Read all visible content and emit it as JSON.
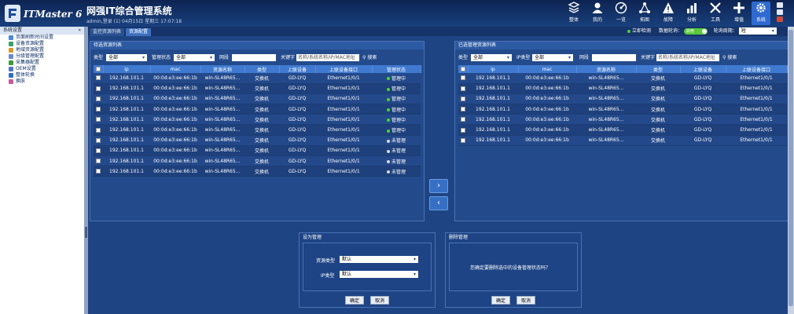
{
  "header": {
    "logo_text": "ITMaster 6",
    "title": "网强IT综合管理系统",
    "login_info": "admin,登录 (1) 04月15日 星期三 17:07:18",
    "nav": [
      {
        "label": "整体",
        "icon": "overview-icon"
      },
      {
        "label": "我的",
        "icon": "user-icon"
      },
      {
        "label": "一览",
        "icon": "dashboard-icon"
      },
      {
        "label": "拓图",
        "icon": "topology-icon"
      },
      {
        "label": "故障",
        "icon": "warning-icon"
      },
      {
        "label": "分析",
        "icon": "chart-icon"
      },
      {
        "label": "工具",
        "icon": "tools-icon"
      },
      {
        "label": "增值",
        "icon": "plus-icon"
      },
      {
        "label": "系统",
        "icon": "gear-icon"
      }
    ]
  },
  "sidebar": {
    "title": "系统设置",
    "items": [
      {
        "label": "页面刷新时间设置"
      },
      {
        "label": "设备资源配置"
      },
      {
        "label": "地域资源配置"
      },
      {
        "label": "分级管理配置"
      },
      {
        "label": "采集器配置"
      },
      {
        "label": "OEM设置"
      },
      {
        "label": "整体轮换"
      },
      {
        "label": "换肤"
      }
    ]
  },
  "tabs": [
    {
      "label": "监控资源列表"
    },
    {
      "label": "资源配置"
    }
  ],
  "controls": {
    "instant_detect": "立即检测",
    "data_poll_label": "数据轮询：",
    "data_poll_value": "启用",
    "poll_cycle_label": "轮询周期：",
    "poll_cycle_value": "短"
  },
  "left_panel": {
    "title": "待选资源列表",
    "filter": {
      "type_label": "类型",
      "type_value": "全部",
      "status_label": "管理状态",
      "status_value": "全部",
      "segment_label": "网段",
      "keyword_label": "关键字",
      "keyword_placeholder": "名称/系统名称/IP/MAC地址",
      "search": "搜索"
    },
    "columns": [
      "ip",
      "mac",
      "资源名称",
      "类型",
      "上联设备",
      "上联设备接口",
      "管理状态"
    ],
    "rows": [
      {
        "ip": "192.168.101.1",
        "mac": "00:0d:e3:ee:66:1b",
        "name": "win-SL48R65...",
        "type": "交换机",
        "uplink": "GD-LYQ",
        "port": "Ethernet1/0/1",
        "status": "管理中"
      },
      {
        "ip": "192.168.101.1",
        "mac": "00:0d:e3:ee:66:1b",
        "name": "win-SL48R65...",
        "type": "交换机",
        "uplink": "GD-LYQ",
        "port": "Ethernet1/0/1",
        "status": "管理中"
      },
      {
        "ip": "192.168.101.1",
        "mac": "00:0d:e3:ee:66:1b",
        "name": "win-SL48R65...",
        "type": "交换机",
        "uplink": "GD-LYQ",
        "port": "Ethernet1/0/1",
        "status": "管理中"
      },
      {
        "ip": "192.168.101.1",
        "mac": "00:0d:e3:ee:66:1b",
        "name": "win-SL48R65...",
        "type": "交换机",
        "uplink": "GD-LYQ",
        "port": "Ethernet1/0/1",
        "status": "管理中"
      },
      {
        "ip": "192.168.101.1",
        "mac": "00:0d:e3:ee:66:1b",
        "name": "win-SL48R65...",
        "type": "交换机",
        "uplink": "GD-LYQ",
        "port": "Ethernet1/0/1",
        "status": "管理中"
      },
      {
        "ip": "192.168.101.1",
        "mac": "00:0d:e3:ee:66:1b",
        "name": "win-SL48R65...",
        "type": "交换机",
        "uplink": "GD-LYQ",
        "port": "Ethernet1/0/1",
        "status": "管理中"
      },
      {
        "ip": "192.168.101.1",
        "mac": "00:0d:e3:ee:66:1b",
        "name": "win-SL48R65...",
        "type": "交换机",
        "uplink": "GD-LYQ",
        "port": "Ethernet1/0/1",
        "status": "未管理"
      },
      {
        "ip": "192.168.101.1",
        "mac": "00:0d:e3:ee:66:1b",
        "name": "win-SL48R65...",
        "type": "交换机",
        "uplink": "GD-LYQ",
        "port": "Ethernet1/0/1",
        "status": "未管理"
      },
      {
        "ip": "192.168.101.1",
        "mac": "00:0d:e3:ee:66:1b",
        "name": "win-SL48R65...",
        "type": "交换机",
        "uplink": "GD-LYQ",
        "port": "Ethernet1/0/1",
        "status": "未管理"
      },
      {
        "ip": "192.168.101.1",
        "mac": "00:0d:e3:ee:66:1b",
        "name": "win-SL48R65...",
        "type": "交换机",
        "uplink": "GD-LYQ",
        "port": "Ethernet1/0/1",
        "status": "未管理"
      }
    ]
  },
  "right_panel": {
    "title": "已选管理资源列表",
    "filter": {
      "type_label": "类型",
      "type_value": "全部",
      "ip_type_label": "IP类型",
      "ip_type_value": "全部",
      "segment_label": "网段",
      "keyword_label": "关键字",
      "keyword_placeholder": "名称/系统名称/IP/MAC地址",
      "search": "搜索"
    },
    "columns": [
      "ip",
      "mac",
      "资源名称",
      "类型",
      "上联设备",
      "上联设备接口"
    ],
    "rows": [
      {
        "ip": "192.168.101.1",
        "mac": "00:0d:e3:ee:66:1b",
        "name": "win-SL48R65...",
        "type": "交换机",
        "uplink": "GD-LYQ",
        "port": "Ethernet1/0/1"
      },
      {
        "ip": "192.168.101.1",
        "mac": "00:0d:e3:ee:66:1b",
        "name": "win-SL48R65...",
        "type": "交换机",
        "uplink": "GD-LYQ",
        "port": "Ethernet1/0/1"
      },
      {
        "ip": "192.168.101.1",
        "mac": "00:0d:e3:ee:66:1b",
        "name": "win-SL48R65...",
        "type": "交换机",
        "uplink": "GD-LYQ",
        "port": "Ethernet1/0/1"
      },
      {
        "ip": "192.168.101.1",
        "mac": "00:0d:e3:ee:66:1b",
        "name": "win-SL48R65...",
        "type": "交换机",
        "uplink": "GD-LYQ",
        "port": "Ethernet1/0/1"
      },
      {
        "ip": "192.168.101.1",
        "mac": "00:0d:e3:ee:66:1b",
        "name": "win-SL48R65...",
        "type": "交换机",
        "uplink": "GD-LYQ",
        "port": "Ethernet1/0/1"
      },
      {
        "ip": "192.168.101.1",
        "mac": "00:0d:e3:ee:66:1b",
        "name": "win-SL48R65...",
        "type": "交换机",
        "uplink": "GD-LYQ",
        "port": "Ethernet1/0/1"
      },
      {
        "ip": "192.168.101.1",
        "mac": "00:0d:e3:ee:66:1b",
        "name": "win-SL48R65...",
        "type": "交换机",
        "uplink": "GD-LYQ",
        "port": "Ethernet1/0/1"
      }
    ]
  },
  "move": {
    "right": "›",
    "left": "‹"
  },
  "set_dialog": {
    "title": "设为管理",
    "resource_type_label": "资源类型",
    "resource_type_value": "默认",
    "ip_type_label": "IP类型",
    "ip_type_value": "默认",
    "ok": "确定",
    "cancel": "取消"
  },
  "delete_dialog": {
    "title": "删除管理",
    "message": "您确定要删除选中的设备管理状态吗？",
    "ok": "确定",
    "cancel": "取消"
  },
  "colors": {
    "managed": "#4cd13a",
    "unmanaged": "#d5dbe5",
    "accent": "#3f7ad0"
  }
}
